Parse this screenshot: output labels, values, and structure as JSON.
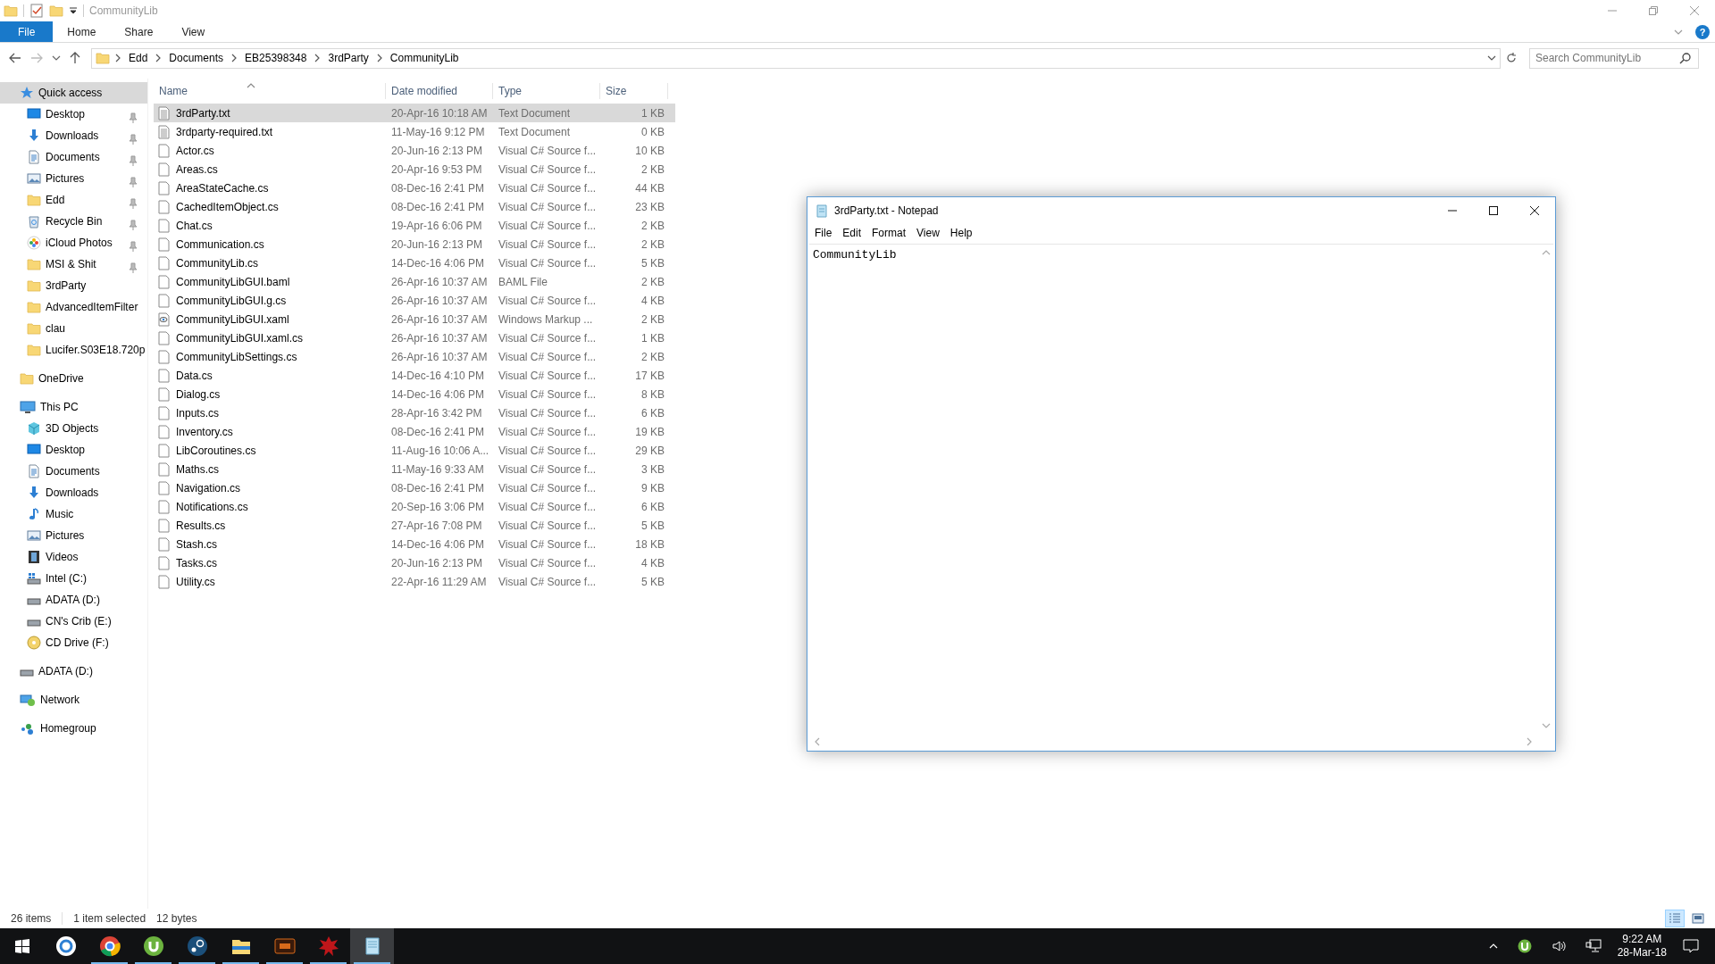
{
  "explorer": {
    "title": "CommunityLib",
    "ribbon_tabs": [
      {
        "label": "File",
        "kind": "file",
        "selected": false
      },
      {
        "label": "Home",
        "kind": "tab",
        "selected": false
      },
      {
        "label": "Share",
        "kind": "tab",
        "selected": false
      },
      {
        "label": "View",
        "kind": "tab",
        "selected": false
      }
    ],
    "help": "?",
    "breadcrumbs": [
      "Edd",
      "Documents",
      "EB25398348",
      "3rdParty",
      "CommunityLib"
    ],
    "search": {
      "placeholder": "Search CommunityLib"
    },
    "nav": [
      {
        "label": "Quick access",
        "kind": "star",
        "selected": true,
        "children": [
          {
            "label": "Desktop",
            "kind": "desktop",
            "pinned": true,
            "selected": false
          },
          {
            "label": "Downloads",
            "kind": "download",
            "pinned": true,
            "selected": false
          },
          {
            "label": "Documents",
            "kind": "documents",
            "pinned": true,
            "selected": false
          },
          {
            "label": "Pictures",
            "kind": "pictures",
            "pinned": true,
            "selected": false
          },
          {
            "label": "Edd",
            "kind": "folder",
            "pinned": true,
            "selected": false
          },
          {
            "label": "Recycle Bin",
            "kind": "recycle",
            "pinned": true,
            "selected": false
          },
          {
            "label": "iCloud Photos",
            "kind": "photos",
            "pinned": true,
            "selected": false
          },
          {
            "label": "MSI & Shit",
            "kind": "folder",
            "pinned": true,
            "selected": false
          },
          {
            "label": "3rdParty",
            "kind": "folder",
            "pinned": false,
            "selected": false
          },
          {
            "label": "AdvancedItemFilter",
            "kind": "folder",
            "pinned": false,
            "selected": false
          },
          {
            "label": "clau",
            "kind": "folder",
            "pinned": false,
            "selected": false
          },
          {
            "label": "Lucifer.S03E18.720p",
            "kind": "folder",
            "pinned": false,
            "selected": false
          }
        ]
      },
      {
        "label": "OneDrive",
        "kind": "folder",
        "selected": false
      },
      {
        "label": "This PC",
        "kind": "pc",
        "selected": false,
        "children": [
          {
            "label": "3D Objects",
            "kind": "cube",
            "selected": false
          },
          {
            "label": "Desktop",
            "kind": "desktop",
            "selected": false
          },
          {
            "label": "Documents",
            "kind": "documents",
            "selected": false
          },
          {
            "label": "Downloads",
            "kind": "download",
            "selected": false
          },
          {
            "label": "Music",
            "kind": "music",
            "selected": false
          },
          {
            "label": "Pictures",
            "kind": "pictures",
            "selected": false
          },
          {
            "label": "Videos",
            "kind": "video",
            "selected": false
          },
          {
            "label": "Intel (C:)",
            "kind": "windrive",
            "selected": false
          },
          {
            "label": "ADATA (D:)",
            "kind": "drive",
            "selected": false
          },
          {
            "label": "CN's Crib (E:)",
            "kind": "drive",
            "selected": false
          },
          {
            "label": "CD Drive (F:)",
            "kind": "cd",
            "selected": false
          }
        ]
      },
      {
        "label": "ADATA (D:)",
        "kind": "drive",
        "selected": false
      },
      {
        "label": "Network",
        "kind": "network",
        "selected": false
      },
      {
        "label": "Homegroup",
        "kind": "homegroup",
        "selected": false
      }
    ],
    "columns": [
      "Name",
      "Date modified",
      "Type",
      "Size"
    ],
    "files": [
      {
        "name": "3rdParty.txt",
        "date": "20-Apr-16 10:18 AM",
        "type": "Text Document",
        "size": "1 KB",
        "kind": "text",
        "selected": true
      },
      {
        "name": "3rdparty-required.txt",
        "date": "11-May-16 9:12 PM",
        "type": "Text Document",
        "size": "0 KB",
        "kind": "text",
        "selected": false
      },
      {
        "name": "Actor.cs",
        "date": "20-Jun-16 2:13 PM",
        "type": "Visual C# Source f...",
        "size": "10 KB",
        "kind": "code",
        "selected": false
      },
      {
        "name": "Areas.cs",
        "date": "20-Apr-16 9:53 PM",
        "type": "Visual C# Source f...",
        "size": "2 KB",
        "kind": "code",
        "selected": false
      },
      {
        "name": "AreaStateCache.cs",
        "date": "08-Dec-16 2:41 PM",
        "type": "Visual C# Source f...",
        "size": "44 KB",
        "kind": "code",
        "selected": false
      },
      {
        "name": "CachedItemObject.cs",
        "date": "08-Dec-16 2:41 PM",
        "type": "Visual C# Source f...",
        "size": "23 KB",
        "kind": "code",
        "selected": false
      },
      {
        "name": "Chat.cs",
        "date": "19-Apr-16 6:06 PM",
        "type": "Visual C# Source f...",
        "size": "2 KB",
        "kind": "code",
        "selected": false
      },
      {
        "name": "Communication.cs",
        "date": "20-Jun-16 2:13 PM",
        "type": "Visual C# Source f...",
        "size": "2 KB",
        "kind": "code",
        "selected": false
      },
      {
        "name": "CommunityLib.cs",
        "date": "14-Dec-16 4:06 PM",
        "type": "Visual C# Source f...",
        "size": "5 KB",
        "kind": "code",
        "selected": false
      },
      {
        "name": "CommunityLibGUI.baml",
        "date": "26-Apr-16 10:37 AM",
        "type": "BAML File",
        "size": "2 KB",
        "kind": "code",
        "selected": false
      },
      {
        "name": "CommunityLibGUI.g.cs",
        "date": "26-Apr-16 10:37 AM",
        "type": "Visual C# Source f...",
        "size": "4 KB",
        "kind": "code",
        "selected": false
      },
      {
        "name": "CommunityLibGUI.xaml",
        "date": "26-Apr-16 10:37 AM",
        "type": "Windows Markup ...",
        "size": "2 KB",
        "kind": "markup",
        "selected": false
      },
      {
        "name": "CommunityLibGUI.xaml.cs",
        "date": "26-Apr-16 10:37 AM",
        "type": "Visual C# Source f...",
        "size": "1 KB",
        "kind": "code",
        "selected": false
      },
      {
        "name": "CommunityLibSettings.cs",
        "date": "26-Apr-16 10:37 AM",
        "type": "Visual C# Source f...",
        "size": "2 KB",
        "kind": "code",
        "selected": false
      },
      {
        "name": "Data.cs",
        "date": "14-Dec-16 4:10 PM",
        "type": "Visual C# Source f...",
        "size": "17 KB",
        "kind": "code",
        "selected": false
      },
      {
        "name": "Dialog.cs",
        "date": "14-Dec-16 4:06 PM",
        "type": "Visual C# Source f...",
        "size": "8 KB",
        "kind": "code",
        "selected": false
      },
      {
        "name": "Inputs.cs",
        "date": "28-Apr-16 3:42 PM",
        "type": "Visual C# Source f...",
        "size": "6 KB",
        "kind": "code",
        "selected": false
      },
      {
        "name": "Inventory.cs",
        "date": "08-Dec-16 2:41 PM",
        "type": "Visual C# Source f...",
        "size": "19 KB",
        "kind": "code",
        "selected": false
      },
      {
        "name": "LibCoroutines.cs",
        "date": "11-Aug-16 10:06 A...",
        "type": "Visual C# Source f...",
        "size": "29 KB",
        "kind": "code",
        "selected": false
      },
      {
        "name": "Maths.cs",
        "date": "11-May-16 9:33 AM",
        "type": "Visual C# Source f...",
        "size": "3 KB",
        "kind": "code",
        "selected": false
      },
      {
        "name": "Navigation.cs",
        "date": "08-Dec-16 2:41 PM",
        "type": "Visual C# Source f...",
        "size": "9 KB",
        "kind": "code",
        "selected": false
      },
      {
        "name": "Notifications.cs",
        "date": "20-Sep-16 3:06 PM",
        "type": "Visual C# Source f...",
        "size": "6 KB",
        "kind": "code",
        "selected": false
      },
      {
        "name": "Results.cs",
        "date": "27-Apr-16 7:08 PM",
        "type": "Visual C# Source f...",
        "size": "5 KB",
        "kind": "code",
        "selected": false
      },
      {
        "name": "Stash.cs",
        "date": "14-Dec-16 4:06 PM",
        "type": "Visual C# Source f...",
        "size": "18 KB",
        "kind": "code",
        "selected": false
      },
      {
        "name": "Tasks.cs",
        "date": "20-Jun-16 2:13 PM",
        "type": "Visual C# Source f...",
        "size": "4 KB",
        "kind": "code",
        "selected": false
      },
      {
        "name": "Utility.cs",
        "date": "22-Apr-16 11:29 AM",
        "type": "Visual C# Source f...",
        "size": "5 KB",
        "kind": "code",
        "selected": false
      }
    ],
    "status_bar": [
      "26 items",
      "1 item selected",
      "12 bytes"
    ],
    "views": [
      {
        "kind": "details",
        "selected": true
      },
      {
        "kind": "large",
        "selected": false
      }
    ]
  },
  "notepad": {
    "title": "3rdParty.txt - Notepad",
    "menu": [
      "File",
      "Edit",
      "Format",
      "View",
      "Help"
    ],
    "text": "CommunityLib"
  },
  "taskbar": [
    {
      "kind": "start",
      "running": false,
      "selected": false
    },
    {
      "kind": "ring",
      "running": false,
      "selected": false
    },
    {
      "kind": "browser",
      "running": true,
      "selected": false
    },
    {
      "kind": "torrent",
      "running": true,
      "selected": false
    },
    {
      "kind": "steam",
      "running": true,
      "selected": false
    },
    {
      "kind": "folder",
      "running": true,
      "selected": false
    },
    {
      "kind": "game",
      "running": true,
      "selected": false
    },
    {
      "kind": "splat",
      "running": true,
      "selected": false
    },
    {
      "kind": "notepad",
      "running": true,
      "selected": true
    }
  ],
  "tray": {
    "time": "9:22 AM",
    "date": "28-Mar-18"
  }
}
